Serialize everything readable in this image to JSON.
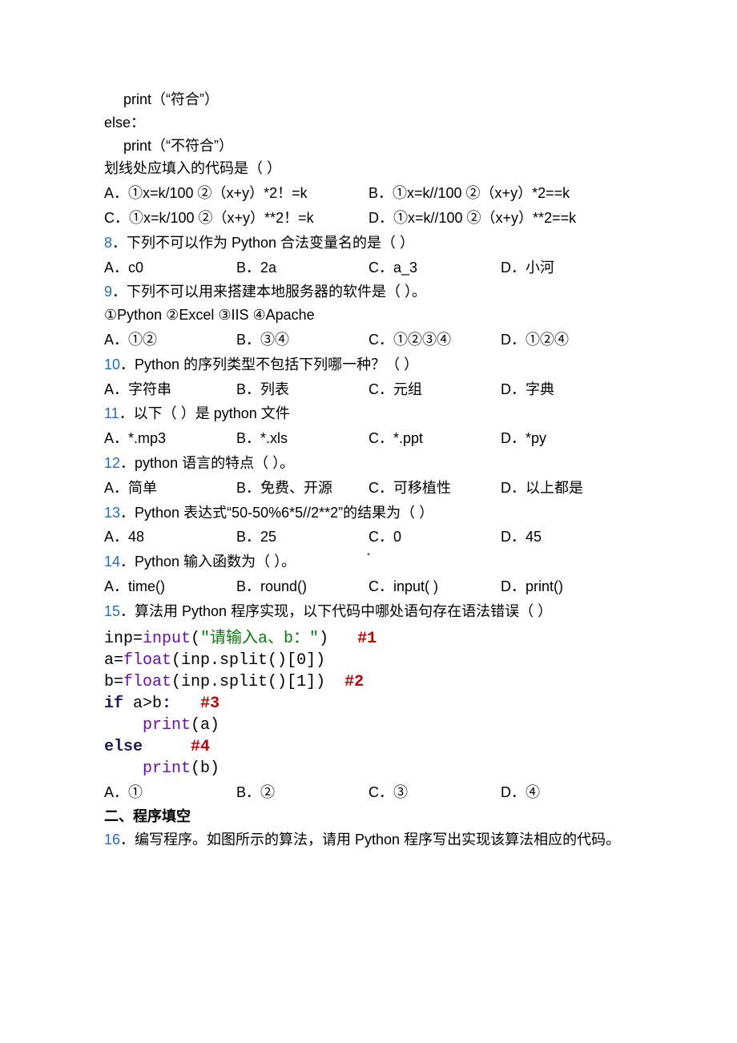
{
  "codeFragment": {
    "l1": "print（“符合”）",
    "l2": "else：",
    "l3": "print（“不符合”）",
    "l4": "划线处应填入的代码是（  ）"
  },
  "q7opts": {
    "A": "A．①x=k/100  ②（x+y）*2！=k",
    "B": "B．①x=k//100  ②（x+y）*2==k",
    "C": "C．①x=k/100  ②（x+y）**2！=k",
    "D": "D．①x=k//100  ②（x+y）**2==k"
  },
  "q8": {
    "num": "8",
    "text": "．下列不可以作为 Python 合法变量名的是（   ）",
    "A": "A．c0",
    "B": "B．2a",
    "C": "C．a_3",
    "D": "D．小河"
  },
  "q9": {
    "num": "9",
    "text": "．下列不可以用来搭建本地服务器的软件是（  ）。",
    "sub": "①Python  ②Excel  ③IIS  ④Apache",
    "A": "A．①②",
    "B": "B．③④",
    "C": "C．①②③④",
    "D": "D．①②④"
  },
  "q10": {
    "num": "10",
    "text": "．Python 的序列类型不包括下列哪一种？（  ）",
    "A": "A．字符串",
    "B": "B．列表",
    "C": "C．元组",
    "D": "D．字典"
  },
  "q11": {
    "num": "11",
    "text": "．以下（     ）是 python 文件",
    "A": "A．*.mp3",
    "B": "B．*.xls",
    "C": "C．*.ppt",
    "D": "D．*py"
  },
  "q12": {
    "num": "12",
    "text": "．python 语言的特点（     ）。",
    "A": "A．简单",
    "B": "B．免费、开源",
    "C": "C．可移植性",
    "D": "D．以上都是"
  },
  "q13": {
    "num": "13",
    "text": "．Python 表达式“50-50%6*5//2**2”的结果为（  ）",
    "A": "A．48",
    "B": "B．25",
    "C": "C．0",
    "D": "D．45"
  },
  "q14": {
    "num": "14",
    "text": "．Python 输入函数为（  ）。",
    "A": "A．time()",
    "B": "B．round()",
    "C": "C．input( )",
    "D": "D．print()"
  },
  "q15": {
    "num": "15",
    "text": "．算法用 Python 程序实现，以下代码中哪处语句存在语法错误（  ）",
    "code": {
      "l1a": "inp=",
      "l1b": "input",
      "l1c": "(",
      "l1d": "\"请输入a、b：\"",
      "l1e": ")   ",
      "l1f": "#1",
      "l2a": "a=",
      "l2b": "float",
      "l2c": "(inp.split()[",
      "l2d": "0",
      "l2e": "])",
      "l3a": "b=",
      "l3b": "float",
      "l3c": "(inp.split()[",
      "l3d": "1",
      "l3e": "])  ",
      "l3f": "#2",
      "l4a": "if",
      "l4b": " a>b",
      "l4c": ":",
      "l4d": "   ",
      "l4e": "#3",
      "l5a": "    ",
      "l5b": "print",
      "l5c": "(a)",
      "l6a": "else",
      "l6b": "     ",
      "l6c": "#4",
      "l7a": "    ",
      "l7b": "print",
      "l7c": "(b)"
    },
    "A": "A．①",
    "B": "B．②",
    "C": "C．③",
    "D": "D．④"
  },
  "section2": "二、程序填空",
  "q16": {
    "num": "16",
    "text": "．编写程序。如图所示的算法，请用 Python 程序写出实现该算法相应的代码。"
  },
  "midMark": "▪"
}
